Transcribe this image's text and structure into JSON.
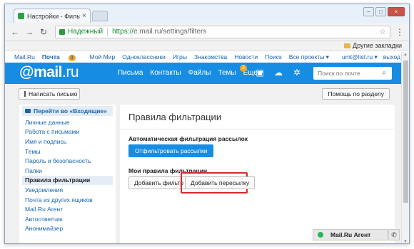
{
  "browser": {
    "tab_title": "Настройки - Фильтры -",
    "tab_close": "×",
    "window_buttons": {
      "minimize": "–",
      "maximize": "□",
      "close": "×"
    },
    "secure_label": "Надежный",
    "url_scheme": "https://",
    "url_rest": "e.mail.ru/settings/filters",
    "bookmarks_other": "Другие закладки"
  },
  "portal": {
    "links": [
      "Mail.Ru",
      "Почта",
      "Мой Мир",
      "Одноклассники",
      "Игры",
      "Знакомства",
      "Новости",
      "Поиск",
      "Все проекты ▾"
    ],
    "mail_badge": "0",
    "user": "umt@list.ru ▾",
    "logout": "выход"
  },
  "header": {
    "logo_at": "@mail",
    "logo_ru": ".ru",
    "nav": [
      "Письма",
      "Контакты",
      "Файлы",
      "Темы",
      "Еще ▾"
    ],
    "more_badge": "3",
    "search_placeholder": "Поиск по почте"
  },
  "toolbar": {
    "compose_label": "Написать письмо",
    "help_label": "Помощь по разделу"
  },
  "sidebar": {
    "inbox_link": "Перейти во «Входящие»",
    "items": [
      "Личные данные",
      "Работа с письмами",
      "Имя и подпись",
      "Темы",
      "Пароль и безопасность",
      "Папки",
      "Правила фильтрации",
      "Уведомления",
      "Почта из других ящиков",
      "Mail.Ru Агент",
      "Автоответчик",
      "Анонимайзер"
    ],
    "active_index": 6
  },
  "main": {
    "title": "Правила фильтрации",
    "auto_section": "Автоматическая фильтрация рассылок",
    "filter_newsletters_button": "Отфильтровать рассылки",
    "my_rules_section": "Мои правила фильтрации",
    "add_filter_button": "Добавить фильтр",
    "add_forward_button": "Добавить пересылку"
  },
  "agent": {
    "label": "Mail.Ru Агент"
  },
  "colors": {
    "brand_blue": "#168de2",
    "highlight_red": "#d42b2b",
    "badge_orange": "#f9a51a"
  }
}
